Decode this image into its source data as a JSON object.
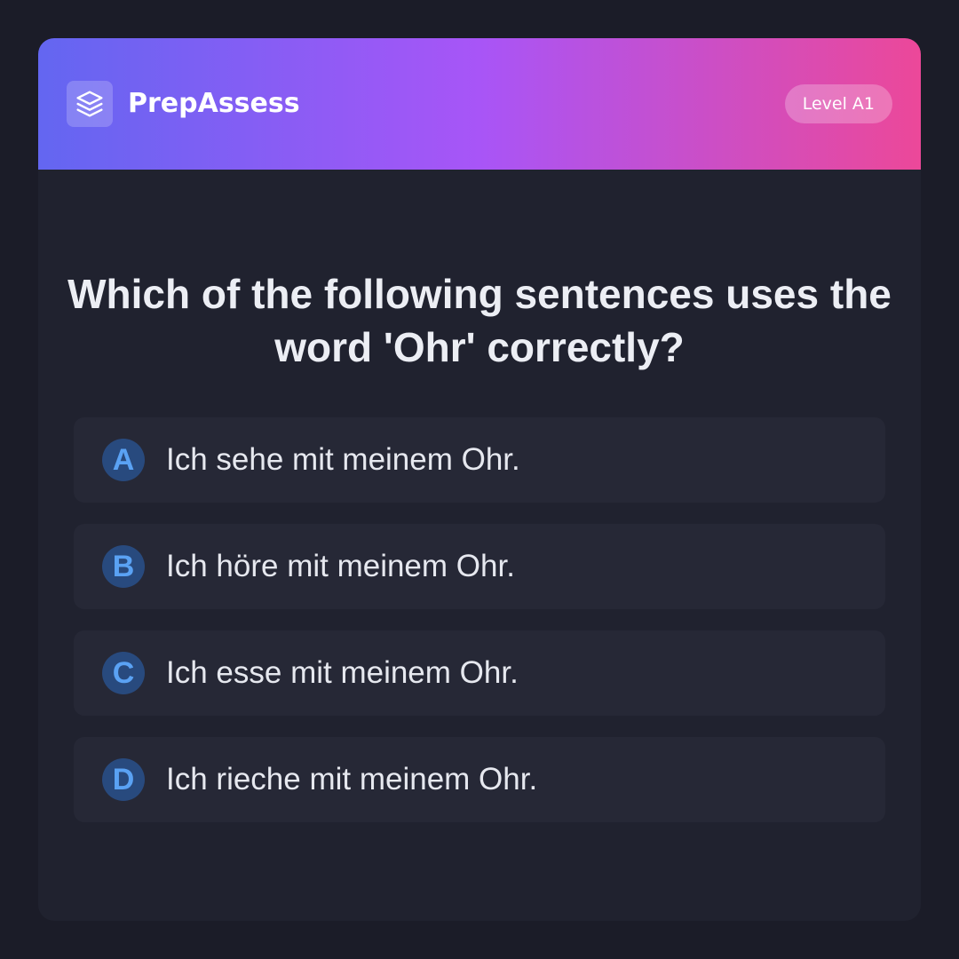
{
  "header": {
    "logo_icon": "layers-icon",
    "brand": "PrepAssess",
    "level": "Level A1",
    "gradient": [
      "#6366f1",
      "#a855f7",
      "#ec4899"
    ]
  },
  "question": {
    "text": "Which of the following sentences uses the word 'Ohr' correctly?"
  },
  "options": [
    {
      "letter": "A",
      "text": "Ich sehe mit meinem Ohr."
    },
    {
      "letter": "B",
      "text": "Ich höre mit meinem Ohr."
    },
    {
      "letter": "C",
      "text": "Ich esse mit meinem Ohr."
    },
    {
      "letter": "D",
      "text": "Ich rieche mit meinem Ohr."
    }
  ]
}
